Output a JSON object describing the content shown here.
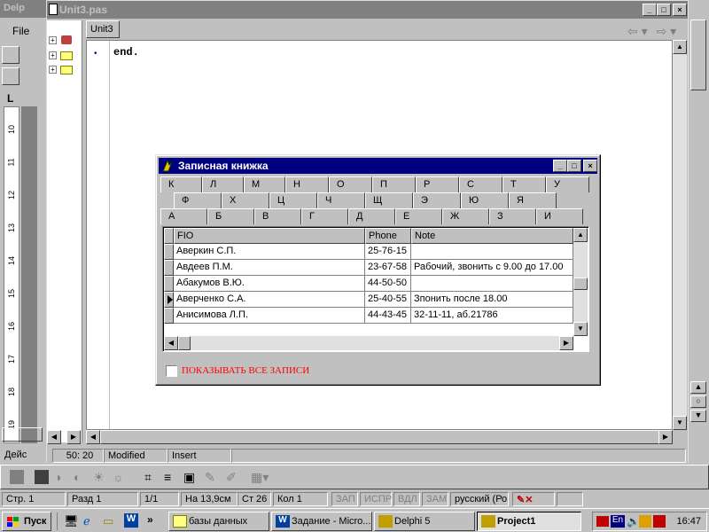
{
  "word": {
    "title": "Delp",
    "menu_file": "File",
    "ruler_numbers": [
      "10",
      "11",
      "12",
      "13",
      "14",
      "15",
      "16",
      "17",
      "18",
      "19"
    ],
    "ruler_mark": "L"
  },
  "editor": {
    "title": "Unit3.pas",
    "tab": "Unit3",
    "code": "end.",
    "status": {
      "position": "50: 20",
      "modified": "Modified",
      "mode": "Insert",
      "left": "Дейс"
    }
  },
  "dialog": {
    "title": "Записная книжка",
    "tab_rows": [
      [
        "К",
        "Л",
        "М",
        "Н",
        "О",
        "П",
        "Р",
        "С",
        "Т",
        "У"
      ],
      [
        "Ф",
        "Х",
        "Ц",
        "Ч",
        "Щ",
        "Э",
        "Ю",
        "Я"
      ],
      [
        "А",
        "Б",
        "В",
        "Г",
        "Д",
        "Е",
        "Ж",
        "З",
        "И"
      ]
    ],
    "active_tab": "А",
    "columns": [
      "FIO",
      "Phone",
      "Note"
    ],
    "rows": [
      {
        "fio": "Аверкин С.П.",
        "phone": "25-76-15",
        "note": ""
      },
      {
        "fio": "Авдеев П.М.",
        "phone": "23-67-58",
        "note": "Рабочий, звонить с 9.00 до 17.00"
      },
      {
        "fio": "Абакумов В.Ю.",
        "phone": "44-50-50",
        "note": ""
      },
      {
        "fio": "Аверченко С.А.",
        "phone": "25-40-55",
        "note": "Зпонить после 18.00"
      },
      {
        "fio": "Анисимова Л.П.",
        "phone": "44-43-45",
        "note": " 32-11-11, аб.21786"
      }
    ],
    "current_row": 3,
    "checkbox_label": "ПОКАЗЫВАТЬ ВСЕ ЗАПИСИ",
    "checkbox_checked": false
  },
  "word_status": {
    "page": "Стр. 1",
    "section": "Разд 1",
    "pages": "1/1",
    "at": "На 13,9см",
    "line": "Ст 26",
    "col": "Кол 1",
    "rec": "ЗАП",
    "trk": "ИСПР",
    "ext": "ВДЛ",
    "ovr": "ЗАМ",
    "lang": "русский (Ро"
  },
  "taskbar": {
    "start": "Пуск",
    "more": "»",
    "tasks": [
      "базы данных",
      "Задание - Micro...",
      "Delphi 5",
      "Project1"
    ],
    "active_task": "Project1",
    "lang_indicator": "En",
    "clock": "16:47"
  },
  "colors": {
    "title_active": "#000080",
    "title_inactive": "#808080",
    "checkbox_text": "#ff0000",
    "face": "#c0c0c0"
  }
}
